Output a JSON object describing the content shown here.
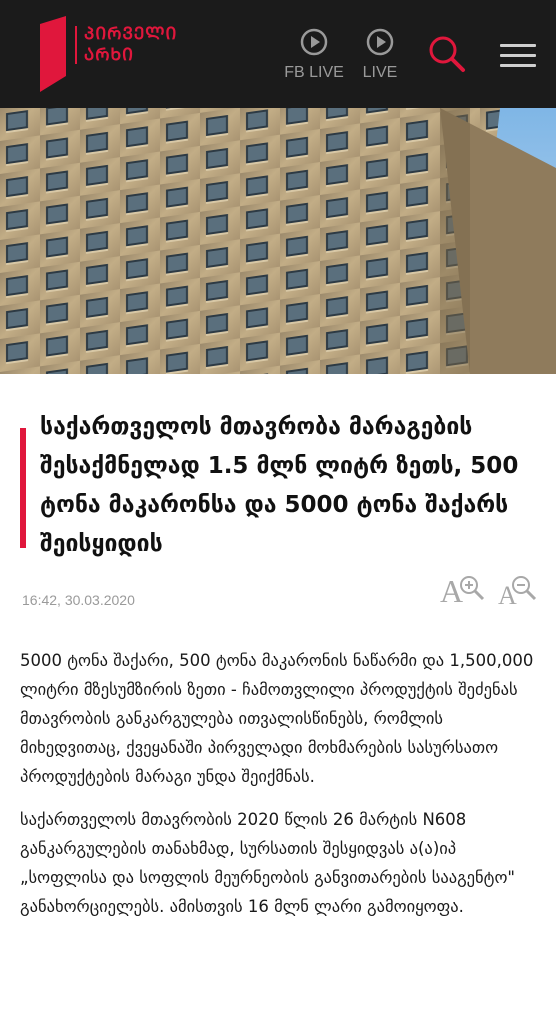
{
  "header": {
    "logo_line1": "ᲞᲘᲠᲕᲔᲚᲘ",
    "logo_line2": "ᲐᲠᲮᲘ",
    "fb_live_label": "FB LIVE",
    "live_label": "LIVE",
    "accent_color": "#e0173c"
  },
  "article": {
    "title": "საქართველოს მთავრობა მარაგების შესაქმნელად 1.5 მლნ ლიტრ ზეთს, 500 ტონა მაკარონსა და 5000 ტონა შაქარს შეისყიდის",
    "date": "16:42, 30.03.2020",
    "paragraphs": [
      "5000 ტონა შაქარი, 500 ტონა მაკარონის ნაწარმი და 1,500,000 ლიტრი მზესუმზირის ზეთი - ჩამოთვლილი პროდუქტის შეძენას მთავრობის განკარგულება ითვალისწინებს, რომლის მიხედვითაც, ქვეყანაში პირველადი მოხმარების სასურსათო პროდუქტების მარაგი უნდა შეიქმნას.",
      "საქართველოს მთავრობის 2020 წლის 26 მარტის N608 განკარგულების თანახმად, სურსათის შესყიდვას ა(ა)იპ „სოფლისა და სოფლის მეურნეობის განვითარების სააგენტო\" განახორციელებს. ამისთვის 16 მლნ ლარი გამოიყოფა."
    ]
  }
}
